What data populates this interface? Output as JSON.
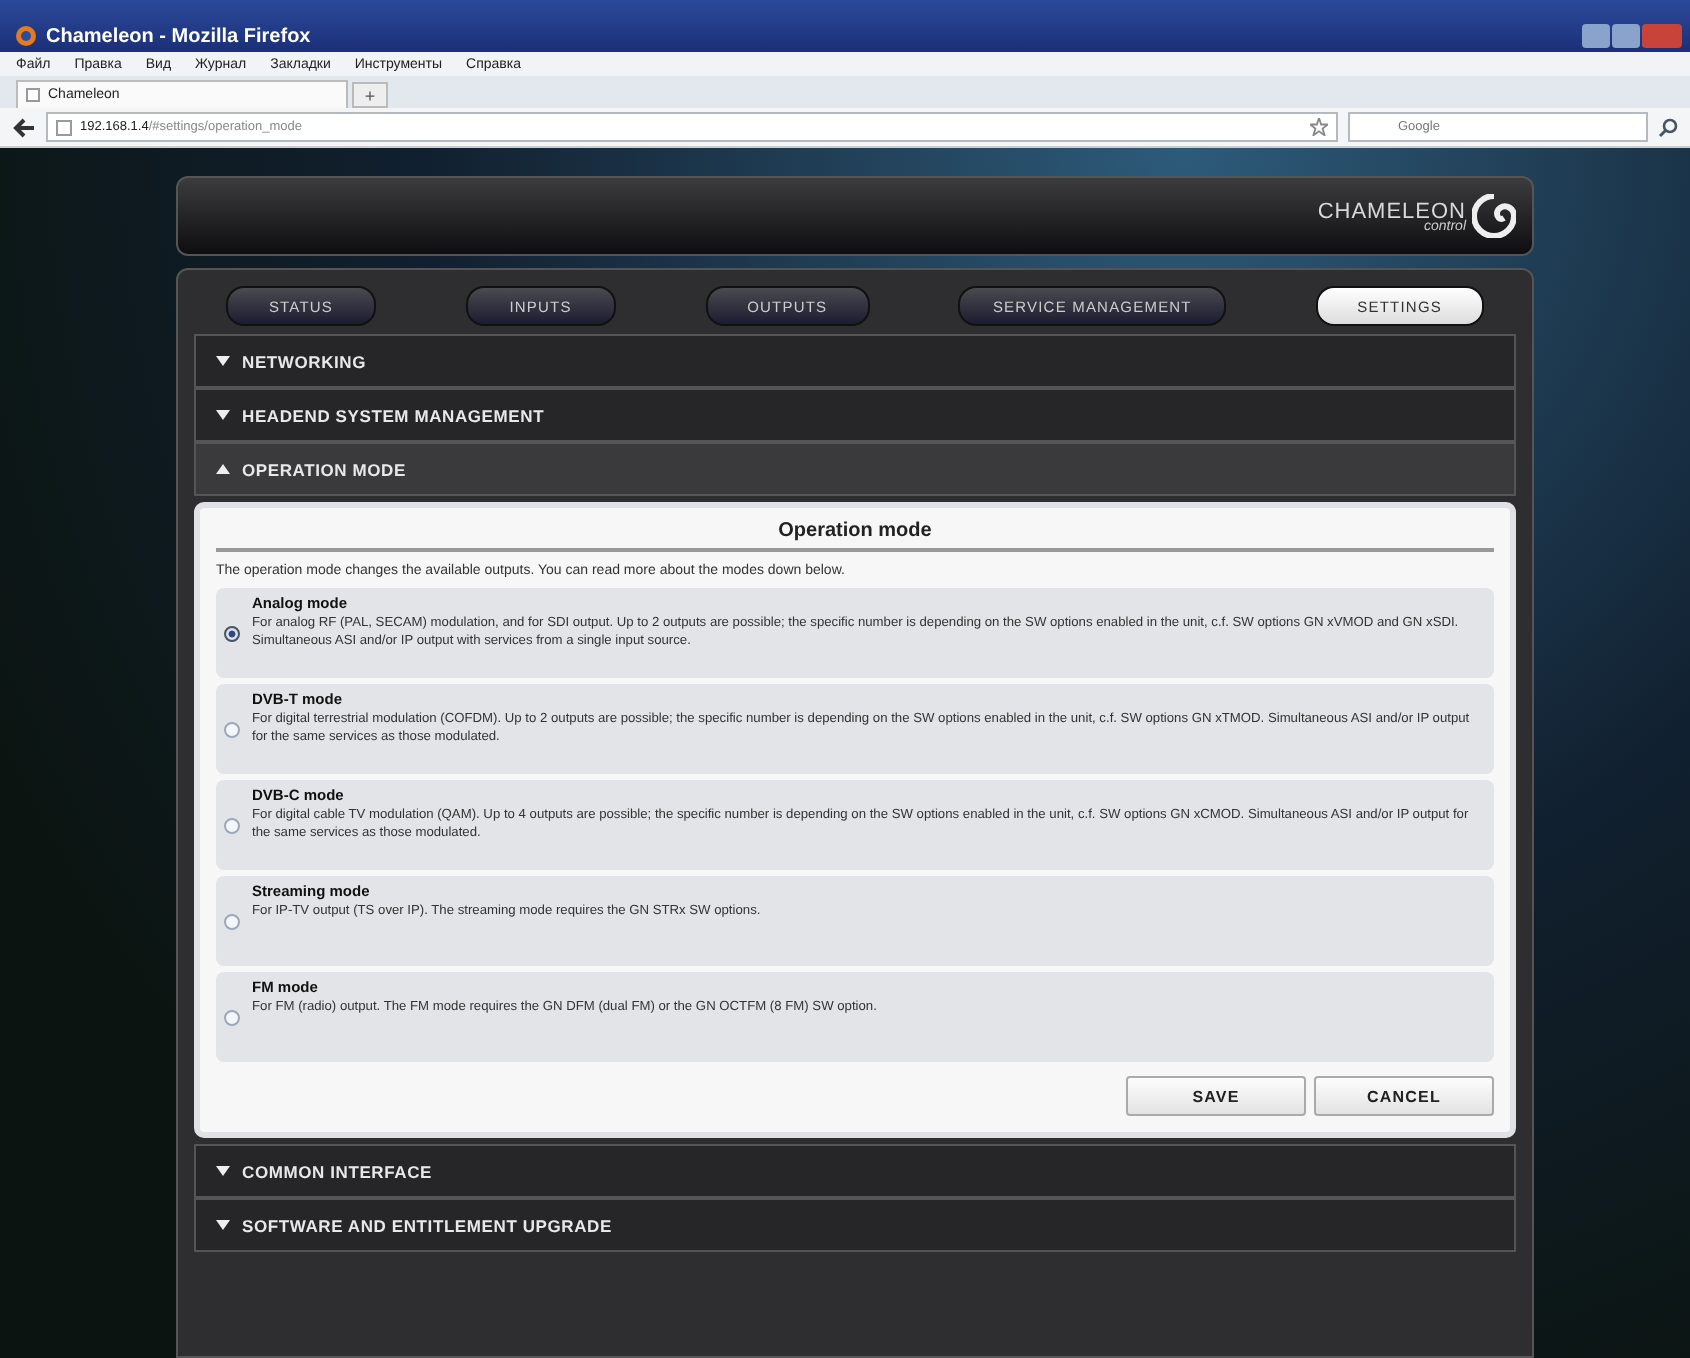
{
  "window": {
    "title": "Chameleon - Mozilla Firefox"
  },
  "menu": [
    "Файл",
    "Правка",
    "Вид",
    "Журнал",
    "Закладки",
    "Инструменты",
    "Справка"
  ],
  "browser_tab": {
    "label": "Chameleon",
    "new_tab": "+"
  },
  "address": {
    "host": "192.168.1.4",
    "path": "/#settings/operation_mode"
  },
  "search": {
    "placeholder": "Google"
  },
  "logo": {
    "name": "CHAMELEON",
    "sub": "control"
  },
  "nav_tabs": [
    {
      "label": "STATUS",
      "selected": false
    },
    {
      "label": "INPUTS",
      "selected": false
    },
    {
      "label": "OUTPUTS",
      "selected": false
    },
    {
      "label": "SERVICE MANAGEMENT",
      "selected": false
    },
    {
      "label": "SETTINGS",
      "selected": true
    }
  ],
  "sections_before": [
    {
      "label": "NETWORKING",
      "expanded": false
    },
    {
      "label": "HEADEND SYSTEM MANAGEMENT",
      "expanded": false
    },
    {
      "label": "OPERATION MODE",
      "expanded": true
    }
  ],
  "form": {
    "title": "Operation mode",
    "intro": "The operation mode changes the available outputs. You can read more about the modes down below.",
    "modes": [
      {
        "name": "Analog mode",
        "description": "For analog RF (PAL, SECAM) modulation, and for SDI output. Up to 2 outputs are possible; the specific number is depending on the SW options enabled in the unit, c.f. SW options GN xVMOD and GN xSDI. Simultaneous ASI and/or IP output with services from a single input source.",
        "selected": true
      },
      {
        "name": "DVB-T mode",
        "description": "For digital terrestrial modulation (COFDM). Up to 2 outputs are possible; the specific number is depending on the SW options enabled in the unit, c.f. SW options GN xTMOD. Simultaneous ASI and/or IP output for the same services as those modulated.",
        "selected": false
      },
      {
        "name": "DVB-C mode",
        "description": "For digital cable TV modulation (QAM). Up to 4 outputs are possible; the specific number is depending on the SW options enabled in the unit, c.f. SW options GN xCMOD. Simultaneous ASI and/or IP output for the same services as those modulated.",
        "selected": false
      },
      {
        "name": "Streaming mode",
        "description": "For IP-TV output (TS over IP). The streaming mode requires the GN STRx SW options.",
        "selected": false
      },
      {
        "name": "FM mode",
        "description": "For FM (radio) output. The FM mode requires the GN DFM (dual FM) or the GN OCTFM (8 FM) SW option.",
        "selected": false
      }
    ],
    "buttons": [
      "SAVE",
      "CANCEL"
    ]
  },
  "sections_after": [
    {
      "label": "COMMON INTERFACE",
      "expanded": false
    },
    {
      "label": "SOFTWARE AND ENTITLEMENT UPGRADE",
      "expanded": false
    }
  ]
}
